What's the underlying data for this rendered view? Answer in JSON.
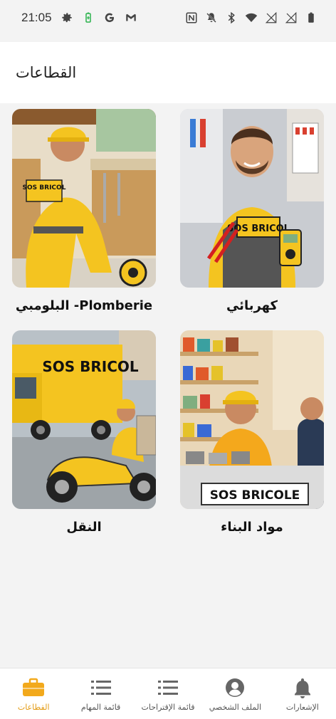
{
  "status_bar": {
    "time": "21:05",
    "left_icons": [
      "gear-icon",
      "battery-saver-icon",
      "google-icon",
      "gmail-icon"
    ],
    "right_icons": [
      "nfc-icon",
      "mute-icon",
      "bluetooth-icon",
      "wifi-icon",
      "no-signal-icon",
      "no-signal-icon",
      "battery-icon"
    ]
  },
  "header": {
    "title": "القطاعات"
  },
  "sectors": [
    {
      "label": "كهربائي",
      "image": "electrician-illustration",
      "image_text": "SOS BRICOL"
    },
    {
      "label": "البلومبي -Plomberie",
      "image": "plumber-illustration",
      "image_text": "SOS BRICOL"
    },
    {
      "label": "مواد البناء",
      "image": "building-materials-shop-illustration",
      "image_text": "SOS BRICOLE"
    },
    {
      "label": "النقل",
      "image": "transport-truck-illustration",
      "image_text": "SOS BRICOL"
    }
  ],
  "bottom_nav": {
    "accent_color": "#f2a91c",
    "items": [
      {
        "label": "القطاعات",
        "icon": "briefcase-icon",
        "active": true
      },
      {
        "label": "قائمة المهام",
        "icon": "list-icon",
        "active": false
      },
      {
        "label": "قائمة الإقتراحات",
        "icon": "list-icon",
        "active": false
      },
      {
        "label": "الملف الشخصي",
        "icon": "account-circle-icon",
        "active": false
      },
      {
        "label": "الإشعارات",
        "icon": "bell-icon",
        "active": false
      }
    ]
  }
}
